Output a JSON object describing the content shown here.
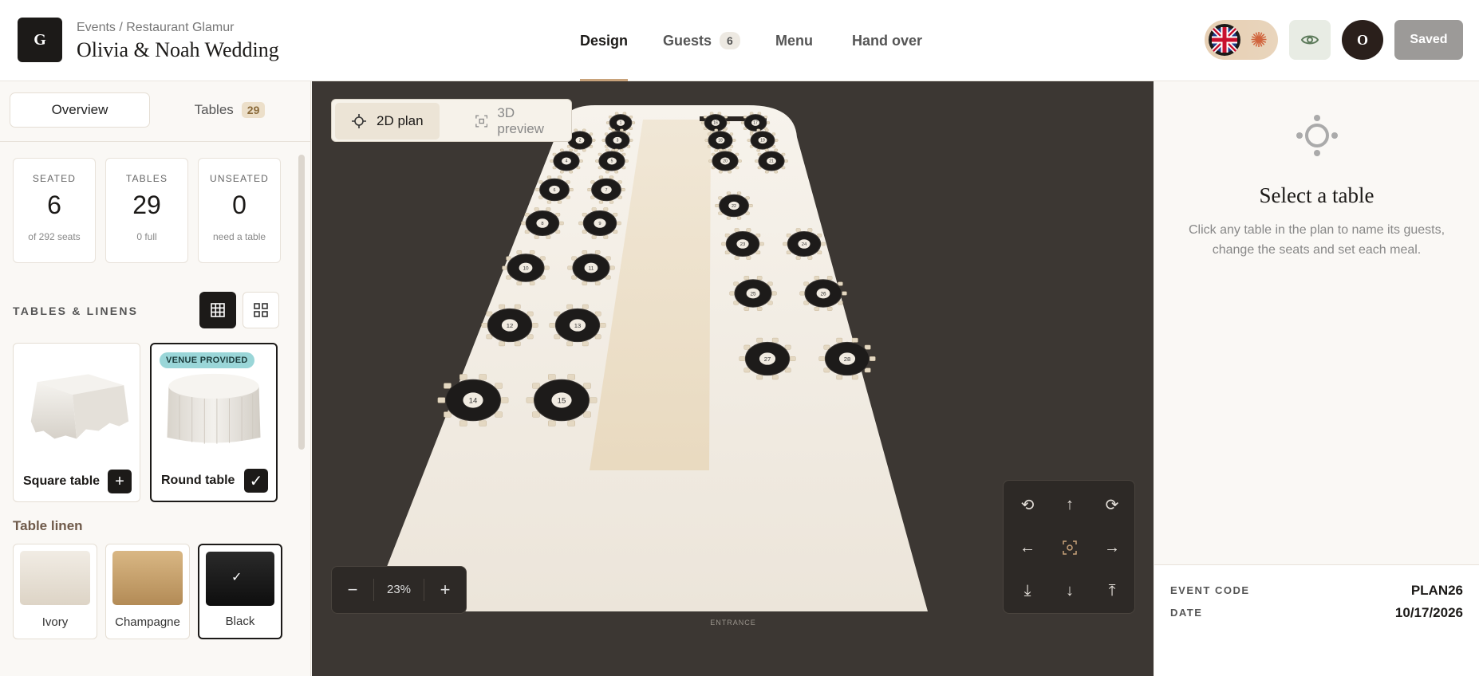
{
  "app": {
    "logo_letter": "G",
    "breadcrumb": "Events / Restaurant Glamur",
    "title": "Olivia & Noah Wedding"
  },
  "nav": {
    "tabs": [
      {
        "label": "Design",
        "active": true
      },
      {
        "label": "Guests",
        "badge": "6"
      },
      {
        "label": "Menu"
      },
      {
        "label": "Hand over"
      }
    ]
  },
  "header_actions": {
    "avatar_letter": "O",
    "saved_label": "Saved",
    "language": "uk-flag-icon"
  },
  "sidebar": {
    "tabs": [
      {
        "label": "Overview",
        "active": true
      },
      {
        "label": "Tables",
        "badge": "29"
      }
    ],
    "stats": [
      {
        "label": "SEATED",
        "value": "6",
        "sub": "of 292 seats"
      },
      {
        "label": "TABLES",
        "value": "29",
        "sub": "0 full"
      },
      {
        "label": "UNSEATED",
        "value": "0",
        "sub": "need a table"
      }
    ],
    "section_title": "TABLES & LINENS",
    "table_types": [
      {
        "label": "Square table",
        "action": "+"
      },
      {
        "label": "Round table",
        "badge": "VENUE PROVIDED",
        "selected": true,
        "action": "✓"
      }
    ],
    "linen_title": "Table linen",
    "linens": [
      {
        "label": "Ivory",
        "color": "#e8e0d4"
      },
      {
        "label": "Champagne",
        "color": "#c8a06a"
      },
      {
        "label": "Black",
        "color": "#1a1a1a",
        "selected": true
      }
    ]
  },
  "canvas": {
    "view_options": [
      {
        "label": "2D plan",
        "active": true
      },
      {
        "label": "3D preview"
      }
    ],
    "zoom": "23%",
    "entrance_label": "ENTRANCE",
    "table_numbers": [
      "1",
      "2",
      "3",
      "4",
      "5",
      "6",
      "7",
      "8",
      "9",
      "10",
      "11",
      "12",
      "13",
      "14",
      "15",
      "16",
      "17",
      "18",
      "19",
      "20",
      "21",
      "22",
      "23",
      "24",
      "25",
      "26",
      "27",
      "28",
      "29"
    ]
  },
  "right_panel": {
    "title": "Select a table",
    "description": "Click any table in the plan to name its guests, change the seats and set each meal.",
    "event_code_label": "EVENT CODE",
    "event_code": "PLAN26",
    "date_label": "DATE",
    "date": "10/17/2026"
  }
}
